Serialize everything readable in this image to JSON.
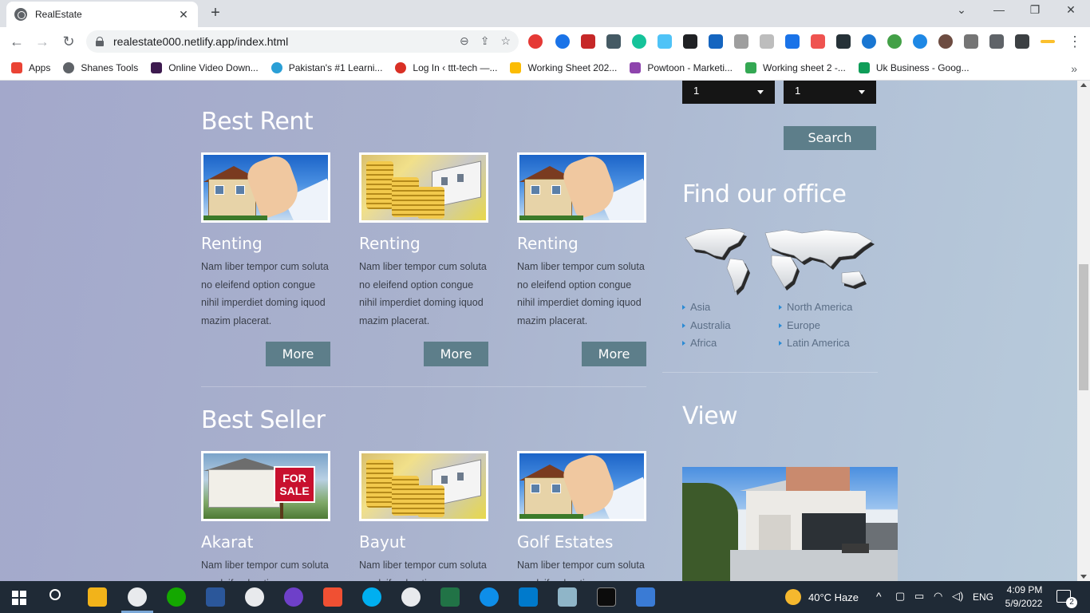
{
  "browser": {
    "tab_title": "RealEstate",
    "tab_close": "✕",
    "new_tab": "+",
    "url": "realestate000.netlify.app/index.html",
    "window_controls": {
      "minimize": "—",
      "restore": "❐",
      "close": "✕"
    },
    "nav": {
      "back": "←",
      "forward": "→",
      "reload": "↻"
    },
    "omni_icons": {
      "zoom": "⊖",
      "share": "⇪",
      "star": "☆"
    },
    "bookmarks": [
      {
        "label": "Apps",
        "icon": "apps-grid-icon",
        "color": "#ea4335"
      },
      {
        "label": "Shanes Tools",
        "icon": "globe-icon",
        "color": "#5f6368"
      },
      {
        "label": "Online Video Down...",
        "icon": "q-icon",
        "color": "#3d1a4f"
      },
      {
        "label": "Pakistan's #1 Learni...",
        "icon": "star-icon",
        "color": "#2a9fd6"
      },
      {
        "label": "Log In ‹ ttt-tech —...",
        "icon": "swirl-icon",
        "color": "#d93025"
      },
      {
        "label": "Working Sheet 202...",
        "icon": "drive-icon",
        "color": "#fbbc04"
      },
      {
        "label": "Powtoon - Marketi...",
        "icon": "powtoon-icon",
        "color": "#8e44ad"
      },
      {
        "label": "Working sheet 2 -...",
        "icon": "drive-icon",
        "color": "#34a853"
      },
      {
        "label": "Uk Business - Goog...",
        "icon": "sheets-icon",
        "color": "#0f9d58"
      }
    ],
    "bookmarks_more": "»"
  },
  "page": {
    "best_rent": {
      "title": "Best Rent",
      "cards": [
        {
          "title": "Renting",
          "text": "Nam liber tempor cum soluta no eleifend option congue nihil imperdiet doming iquod mazim placerat.",
          "button": "More",
          "image": "house-key-hand"
        },
        {
          "title": "Renting",
          "text": "Nam liber tempor cum soluta no eleifend option congue nihil imperdiet doming iquod mazim placerat.",
          "button": "More",
          "image": "gold-coins-house"
        },
        {
          "title": "Renting",
          "text": "Nam liber tempor cum soluta no eleifend option congue nihil imperdiet doming iquod mazim placerat.",
          "button": "More",
          "image": "house-key-hand"
        }
      ]
    },
    "best_seller": {
      "title": "Best Seller",
      "cards": [
        {
          "title": "Akarat",
          "text": "Nam liber tempor cum soluta no eleifend option congue",
          "image": "for-sale-sign",
          "sign_text": "FOR SALE"
        },
        {
          "title": "Bayut",
          "text": "Nam liber tempor cum soluta no eleifend option congue",
          "image": "gold-coins-house"
        },
        {
          "title": "Golf Estates",
          "text": "Nam liber tempor cum soluta no eleifend option congue",
          "image": "house-key-hand"
        }
      ]
    },
    "sidebar": {
      "select_1_value": "1",
      "select_2_value": "1",
      "search_button": "Search",
      "office_title": "Find our office",
      "regions_left": [
        "Asia",
        "Australia",
        "Africa"
      ],
      "regions_right": [
        "North America",
        "Europe",
        "Latin America"
      ],
      "view_title": "View"
    }
  },
  "taskbar": {
    "weather": "40°C  Haze",
    "language": "ENG",
    "time": "4:09 PM",
    "date": "5/9/2022",
    "notifications": "2"
  }
}
